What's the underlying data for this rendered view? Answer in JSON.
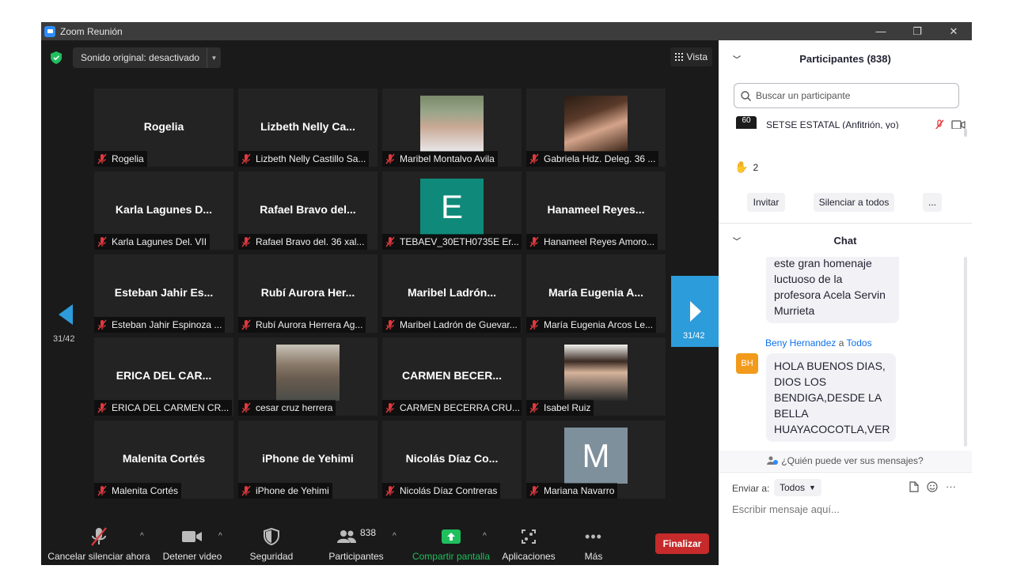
{
  "window": {
    "title": "Zoom Reunión",
    "minimize": "—",
    "restore": "❐",
    "close": "✕"
  },
  "top_bar": {
    "sound": "Sonido original: desactivado",
    "view": "Vista"
  },
  "tiles": [
    {
      "big": "Rogelia",
      "label": "Rogelia"
    },
    {
      "big": "Lizbeth Nelly Ca...",
      "label": "Lizbeth Nelly Castillo Sa..."
    },
    {
      "big": "",
      "label": "Maribel Montalvo Avila"
    },
    {
      "big": "",
      "label": "Gabriela Hdz. Deleg. 36 ..."
    },
    {
      "big": "Karla Lagunes D...",
      "label": "Karla Lagunes Del. VII"
    },
    {
      "big": "Rafael Bravo del...",
      "label": "Rafael Bravo del. 36 xal..."
    },
    {
      "big": "",
      "label": "TEBAEV_30ETH0735E Er...",
      "letter": "E"
    },
    {
      "big": "Hanameel Reyes...",
      "label": "Hanameel Reyes Amoro..."
    },
    {
      "big": "Esteban Jahir Es...",
      "label": "Esteban Jahir Espinoza ..."
    },
    {
      "big": "Rubí Aurora Her...",
      "label": "Rubí Aurora Herrera Ag..."
    },
    {
      "big": "Maribel Ladrón...",
      "label": "Maribel Ladrón de Guevar..."
    },
    {
      "big": "María Eugenia A...",
      "label": "María Eugenia Arcos Le..."
    },
    {
      "big": "ERICA DEL CAR...",
      "label": "ERICA DEL CARMEN CR..."
    },
    {
      "big": "",
      "label": "cesar cruz herrera"
    },
    {
      "big": "CARMEN BECER...",
      "label": "CARMEN BECERRA CRU..."
    },
    {
      "big": "",
      "label": "Isabel Ruiz"
    },
    {
      "big": "Malenita Cortés",
      "label": "Malenita Cortés"
    },
    {
      "big": "iPhone de Yehimi",
      "label": "iPhone de Yehimi"
    },
    {
      "big": "Nicolás Díaz Co...",
      "label": "Nicolás Díaz Contreras"
    },
    {
      "big": "",
      "label": "Mariana Navarro",
      "letter": "M"
    }
  ],
  "pagination": {
    "left": "31/42",
    "right": "31/42"
  },
  "toolbar": {
    "unmute": "Cancelar silenciar ahora",
    "video": "Detener video",
    "security": "Seguridad",
    "participants": "Participantes",
    "participants_count": "838",
    "share": "Compartir pantalla",
    "apps": "Aplicaciones",
    "more": "Más",
    "end": "Finalizar"
  },
  "participants_panel": {
    "title": "Participantes (838)",
    "search_placeholder": "Buscar un participante",
    "host": "SETSE ESTATAL (Anfitrión, yo)",
    "host_avatar": "60",
    "raised_hands": "2",
    "invite": "Invitar",
    "mute_all": "Silenciar a todos",
    "more": "..."
  },
  "chat": {
    "title": "Chat",
    "messages": [
      {
        "text": "este gran homenaje luctuoso de la profesora Acela Servin Murrieta"
      },
      {
        "sender": "Beny Hernandez",
        "to_word": "a",
        "to": "Todos",
        "avatar": "BH",
        "text": "HOLA BUENOS DIAS, DIOS LOS BENDIGA,DESDE LA BELLA HUAYACOCOTLA,VER"
      }
    ],
    "who_sees": "¿Quién puede ver sus mensajes?",
    "send_to_label": "Enviar a:",
    "send_to_value": "Todos",
    "placeholder": "Escribir mensaje aquí..."
  },
  "colors": {
    "accent": "#2d9cdb",
    "end": "#c62a2a",
    "share": "#1fbf5d",
    "avatar_E": "#0f8a7a",
    "avatar_M": "#7e909c",
    "bh": "#f19a1b"
  }
}
